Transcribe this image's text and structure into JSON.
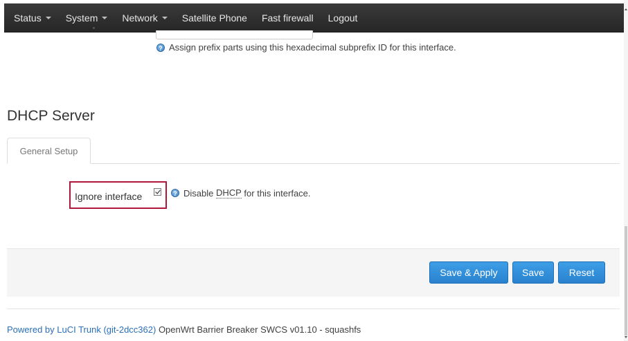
{
  "navbar": {
    "items": [
      {
        "label": "Status",
        "dropdown": true
      },
      {
        "label": "System",
        "dropdown": true
      },
      {
        "label": "Network",
        "dropdown": true
      },
      {
        "label": "Satellite Phone",
        "dropdown": false
      },
      {
        "label": "Fast firewall",
        "dropdown": false
      },
      {
        "label": "Logout",
        "dropdown": false
      }
    ]
  },
  "ipv6": {
    "subprefix_help": "Assign prefix parts using this hexadecimal subprefix ID for this interface."
  },
  "dhcp": {
    "section_title": "DHCP Server",
    "tab_general": "General Setup",
    "ignore_label": "Ignore interface",
    "ignore_checked": true,
    "help_prefix": "Disable ",
    "help_abbr": "DHCP",
    "help_suffix": " for this interface."
  },
  "actions": {
    "save_apply": "Save & Apply",
    "save": "Save",
    "reset": "Reset"
  },
  "footer": {
    "link": "Powered by LuCI Trunk (git-2dcc362)",
    "text": " OpenWrt Barrier Breaker SWCS v01.10 - squashfs"
  },
  "colors": {
    "navbar_bg": "#2f2f2f",
    "button_primary": "#2e8fdb",
    "highlight_border": "#b0163a",
    "link": "#2a6fb8"
  },
  "icons": {
    "help": "help-icon",
    "dropdown": "caret-down-icon"
  }
}
